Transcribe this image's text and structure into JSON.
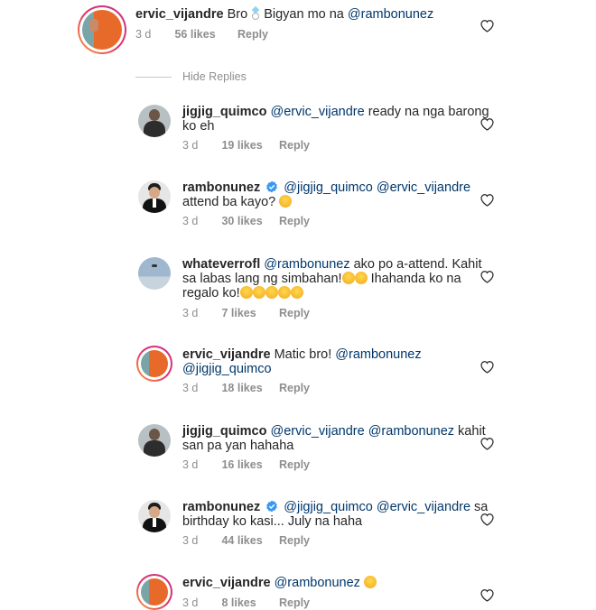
{
  "hide_replies_label": "Hide Replies",
  "colors": {
    "mention": "#00376b",
    "meta": "#8e8e8e",
    "verified": "#3897f0",
    "ring_gradient": [
      "#f9a33a",
      "#e1306c",
      "#c13584"
    ]
  },
  "comments": [
    {
      "user": "ervic_vijandre",
      "pre": "Bro ",
      "emoji_1": "diamond-ring",
      "text_1": " Bigyan mo na ",
      "mention_1": "@rambonunez",
      "time": "3 d",
      "likes": "56 likes",
      "reply": "Reply"
    },
    {
      "user": "jigjig_quimco",
      "mention_1": "@ervic_vijandre",
      "text_1": " ready na nga barong",
      "line2": "ko eh",
      "time": "3 d",
      "likes": "19 likes",
      "reply": "Reply"
    },
    {
      "user": "rambonunez",
      "verified": true,
      "mention_1": "@jigjig_quimco",
      "mention_2": "@ervic_vijandre",
      "line2": "attend ba kayo? ",
      "emoji_1": "smiling-face",
      "time": "3 d",
      "likes": "30 likes",
      "reply": "Reply"
    },
    {
      "user": "whateverrofl",
      "mention_1": "@rambonunez",
      "text_1": " ako po a-attend. Kahit",
      "line2": "sa labas lang ng simbahan!",
      "line2_b": " Ihahanda ko na",
      "line3": "regalo ko!",
      "time": "3 d",
      "likes": "7 likes",
      "reply": "Reply"
    },
    {
      "user": "ervic_vijandre",
      "text_1": "Matic bro! ",
      "mention_1": "@rambonunez",
      "mention_2": "@jigjig_quimco",
      "time": "3 d",
      "likes": "18 likes",
      "reply": "Reply"
    },
    {
      "user": "jigjig_quimco",
      "mention_1": "@ervic_vijandre",
      "mention_2": "@rambonunez",
      "text_1": " kahit",
      "line2": "san pa yan hahaha",
      "time": "3 d",
      "likes": "16 likes",
      "reply": "Reply"
    },
    {
      "user": "rambonunez",
      "verified": true,
      "mention_1": "@jigjig_quimco",
      "mention_2": "@ervic_vijandre",
      "text_1": " sa",
      "line2": "birthday ko kasi... July na haha",
      "time": "3 d",
      "likes": "44 likes",
      "reply": "Reply"
    },
    {
      "user": "ervic_vijandre",
      "mention_1": "@rambonunez",
      "text_1": " ",
      "emoji_1": "rofl",
      "time": "3 d",
      "likes": "8 likes",
      "reply": "Reply"
    }
  ]
}
